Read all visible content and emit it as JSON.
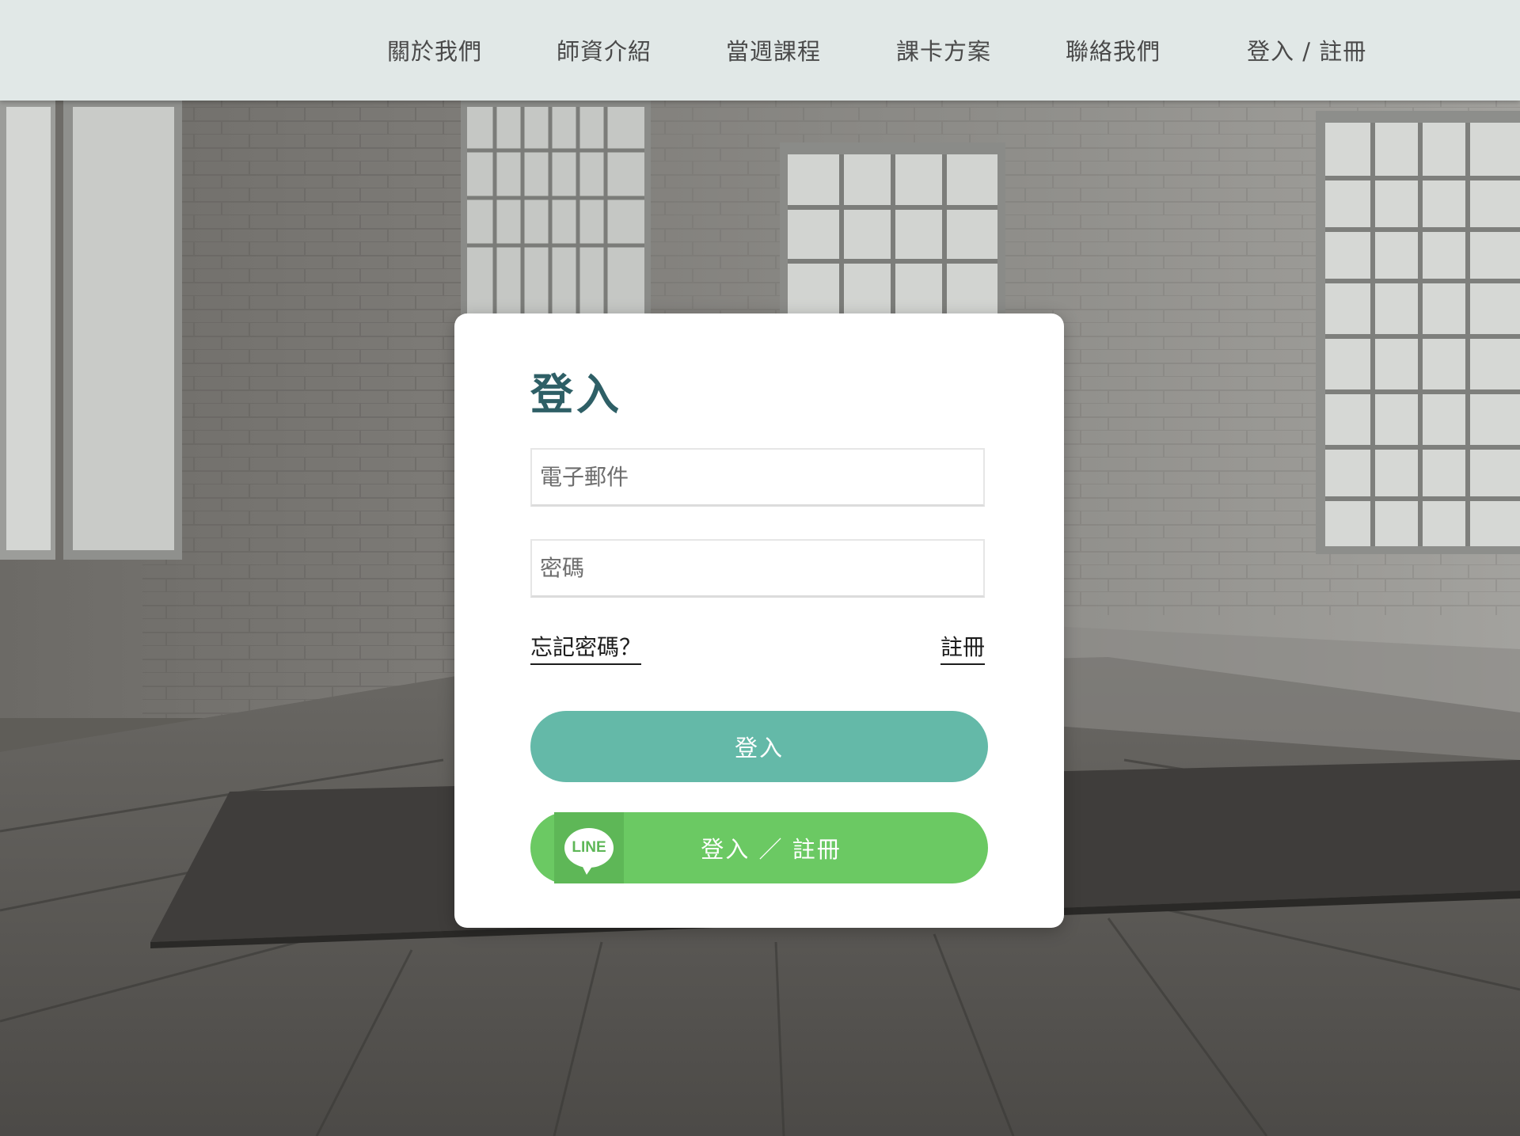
{
  "nav": {
    "items": [
      {
        "label": "關於我們"
      },
      {
        "label": "師資介紹"
      },
      {
        "label": "當週課程"
      },
      {
        "label": "課卡方案"
      },
      {
        "label": "聯絡我們"
      },
      {
        "label": "登入 / 註冊"
      }
    ]
  },
  "login": {
    "title": "登入",
    "email_placeholder": "電子郵件",
    "password_placeholder": "密碼",
    "forgot_label": "忘記密碼？",
    "register_label": "註冊",
    "submit_label": "登入",
    "line_badge_text": "LINE",
    "line_button_label": "登入 ／ 註冊"
  },
  "colors": {
    "nav_bg": "#e1e8e7",
    "title": "#2e5f66",
    "primary_button": "#64b9a8",
    "line_button": "#6bc963"
  }
}
